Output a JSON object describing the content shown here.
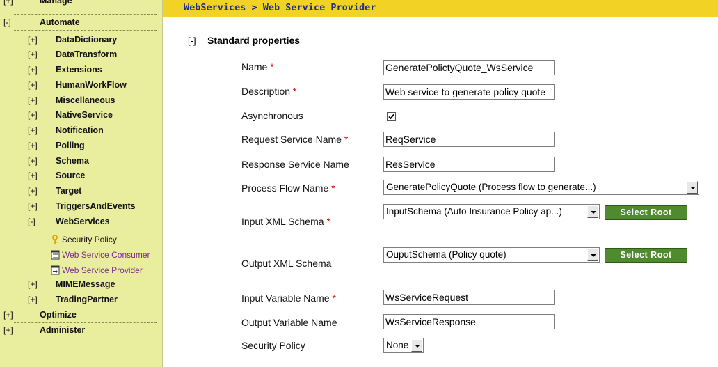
{
  "sidebar": {
    "sections": {
      "manage": {
        "toggle": "[+]",
        "label": "Manage"
      },
      "automate": {
        "toggle": "[-]",
        "label": "Automate"
      },
      "optimize": {
        "toggle": "[+]",
        "label": "Optimize"
      },
      "administer": {
        "toggle": "[+]",
        "label": "Administer"
      }
    },
    "automate_items": [
      {
        "toggle": "[+]",
        "label": "DataDictionary"
      },
      {
        "toggle": "[+]",
        "label": "DataTransform"
      },
      {
        "toggle": "[+]",
        "label": "Extensions"
      },
      {
        "toggle": "[+]",
        "label": "HumanWorkFlow"
      },
      {
        "toggle": "[+]",
        "label": "Miscellaneous"
      },
      {
        "toggle": "[+]",
        "label": "NativeService"
      },
      {
        "toggle": "[+]",
        "label": "Notification"
      },
      {
        "toggle": "[+]",
        "label": "Polling"
      },
      {
        "toggle": "[+]",
        "label": "Schema"
      },
      {
        "toggle": "[+]",
        "label": "Source"
      },
      {
        "toggle": "[+]",
        "label": "Target"
      },
      {
        "toggle": "[+]",
        "label": "TriggersAndEvents"
      },
      {
        "toggle": "[-]",
        "label": "WebServices"
      },
      {
        "toggle": "[+]",
        "label": "MIMEMessage"
      },
      {
        "toggle": "[+]",
        "label": "TradingPartner"
      }
    ],
    "webservices_children": [
      {
        "label": "Security Policy",
        "icon": "key-icon"
      },
      {
        "label": "Web Service Consumer",
        "icon": "document-icon"
      },
      {
        "label": "Web Service Provider",
        "icon": "provider-icon"
      }
    ]
  },
  "header": {
    "breadcrumb": "WebServices > Web Service Provider"
  },
  "section": {
    "toggle": "[-]",
    "title": "Standard properties"
  },
  "form": {
    "required_marker": "*",
    "name": {
      "label": "Name",
      "value": "GeneratePolictyQuote_WsService"
    },
    "description": {
      "label": "Description",
      "value": "Web service to generate policy quote"
    },
    "asynchronous": {
      "label": "Asynchronous",
      "checked": true
    },
    "request_service_name": {
      "label": "Request Service Name",
      "value": "ReqService"
    },
    "response_service_name": {
      "label": "Response Service Name",
      "value": "ResService"
    },
    "process_flow_name": {
      "label": "Process Flow Name",
      "value": "GeneratePolicyQuote (Process flow to generate...)"
    },
    "input_xml_schema": {
      "label": "Input XML Schema",
      "value": "InputSchema (Auto Insurance Policy ap...)",
      "button": "Select Root"
    },
    "output_xml_schema": {
      "label": "Output XML Schema",
      "value": "OuputSchema (Policy quote)",
      "button": "Select Root"
    },
    "input_variable_name": {
      "label": "Input Variable Name",
      "value": "WsServiceRequest"
    },
    "output_variable_name": {
      "label": "Output Variable Name",
      "value": "WsServiceResponse"
    },
    "security_policy": {
      "label": "Security Policy",
      "value": "None"
    }
  },
  "colors": {
    "sidebar_bg": "#e9ee9e",
    "header_bg": "#f2d325",
    "breadcrumb_text": "#1f2f80",
    "button_bg": "#4f8a2d",
    "required": "#d40000",
    "link": "#7b2d8b"
  }
}
